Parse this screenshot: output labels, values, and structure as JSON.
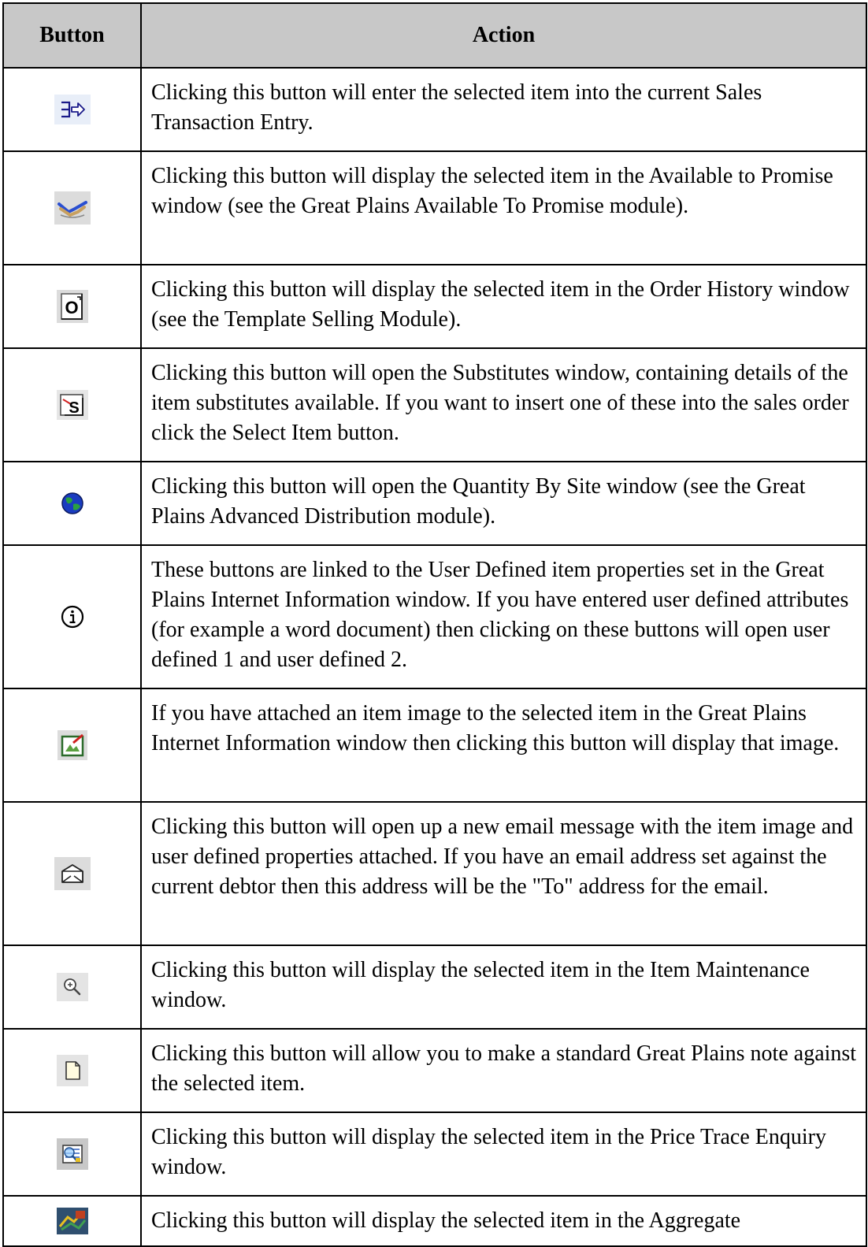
{
  "table": {
    "headers": {
      "button": "Button",
      "action": "Action"
    },
    "rows": [
      {
        "icon": "enter-arrow-icon",
        "action": "Clicking this button will enter the selected item into the current Sales Transaction Entry."
      },
      {
        "icon": "handshake-icon",
        "action": "Clicking this button will display the selected item in the Available to Promise window (see the Great Plains Available To Promise module)."
      },
      {
        "icon": "order-history-icon",
        "action": "Clicking this button will display the selected item in the Order History window (see the Template Selling Module)."
      },
      {
        "icon": "substitutes-icon",
        "action": "Clicking this button will open the Substitutes window, containing details of the item substitutes available. If you want to insert one of these into the sales order click the Select Item button."
      },
      {
        "icon": "globe-icon",
        "action": "Clicking this button will open the Quantity By Site window (see the Great Plains Advanced Distribution module)."
      },
      {
        "icon": "info-icon",
        "action": "These buttons are linked to the User Defined item properties set in the Great Plains Internet Information window. If you have entered user defined attributes (for example a word document) then clicking on these buttons will open user defined 1 and user defined 2."
      },
      {
        "icon": "image-icon",
        "action": "If you have attached an item image to the selected item in the Great Plains Internet Information window then clicking this button will display that image."
      },
      {
        "icon": "email-icon",
        "action": "Clicking this button will open up a new email message with the item image and user defined properties attached. If you have an email address set against the current debtor then this address will be the \"To\" address for the email."
      },
      {
        "icon": "zoom-icon",
        "action": "Clicking this button will display the selected item in the Item Maintenance window."
      },
      {
        "icon": "note-icon",
        "action": "Clicking this button will allow you to make a standard Great Plains note against the selected item."
      },
      {
        "icon": "price-trace-icon",
        "action": "Clicking this button will display the selected item in the Price Trace Enquiry window."
      },
      {
        "icon": "aggregate-icon",
        "action": "Clicking this button will display the selected item in the Aggregate"
      }
    ]
  }
}
